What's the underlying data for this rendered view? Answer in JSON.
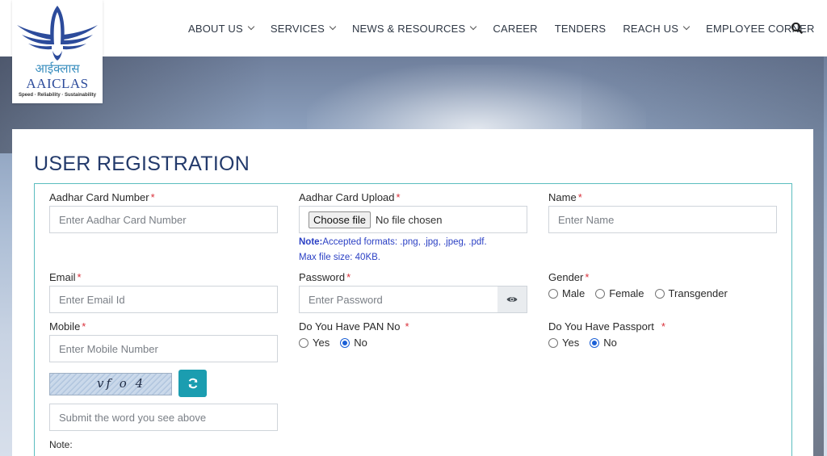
{
  "brand": {
    "logo_hindi": "आईक्लास",
    "logo_name": "AAICLAS",
    "logo_tagline": "Speed · Reliability · Sustainability"
  },
  "nav": {
    "items": [
      {
        "label": "ABOUT US",
        "dropdown": true
      },
      {
        "label": "SERVICES",
        "dropdown": true
      },
      {
        "label": "NEWS & RESOURCES",
        "dropdown": true
      },
      {
        "label": "CAREER",
        "dropdown": false
      },
      {
        "label": "TENDERS",
        "dropdown": false
      },
      {
        "label": "REACH US",
        "dropdown": true
      },
      {
        "label": "EMPLOYEE CORNER",
        "dropdown": false
      }
    ],
    "search_icon": "search-icon"
  },
  "form": {
    "title": "USER REGISTRATION",
    "required_mark": "*",
    "aadhar_number": {
      "label": "Aadhar Card Number",
      "placeholder": "Enter Aadhar Card Number"
    },
    "aadhar_upload": {
      "label": "Aadhar Card Upload",
      "button": "Choose file",
      "status": "No file chosen",
      "note_label": "Note:",
      "note_formats": "Accepted formats: .png, .jpg, .jpeg, .pdf.",
      "note_size": "Max file size: 40KB."
    },
    "name": {
      "label": "Name",
      "placeholder": "Enter Name"
    },
    "email": {
      "label": "Email",
      "placeholder": "Enter Email Id"
    },
    "password": {
      "label": "Password",
      "placeholder": "Enter Password",
      "toggle_icon": "eye-icon"
    },
    "gender": {
      "label": "Gender",
      "options": [
        "Male",
        "Female",
        "Transgender"
      ],
      "selected": null
    },
    "mobile": {
      "label": "Mobile",
      "placeholder": "Enter Mobile Number"
    },
    "pan": {
      "label": "Do You Have PAN No",
      "options": [
        "Yes",
        "No"
      ],
      "selected": "No"
    },
    "passport": {
      "label": "Do You Have Passport",
      "options": [
        "Yes",
        "No"
      ],
      "selected": "No"
    },
    "captcha": {
      "text": "vf o 4",
      "refresh_icon": "refresh-icon",
      "placeholder": "Submit the word you see above"
    },
    "note_label": "Note:"
  },
  "colors": {
    "title": "#233a6b",
    "border_accent": "#5bbdbf",
    "required": "#d9303a",
    "note": "#2a3fc4",
    "refresh_button": "#1b9db0"
  }
}
